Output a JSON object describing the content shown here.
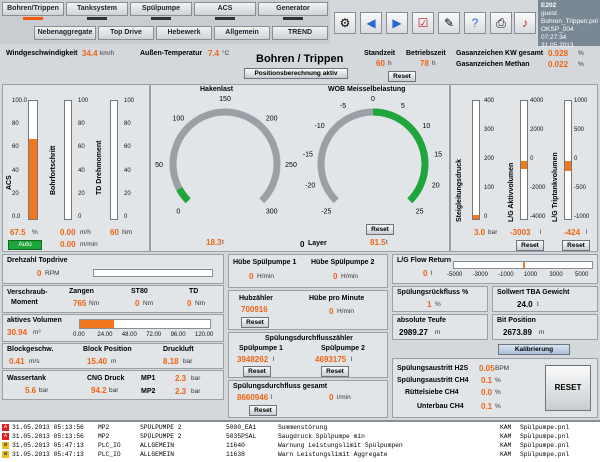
{
  "nav": {
    "row1": [
      "Bohren/Trippen",
      "Tanksystem",
      "Spülpumpe",
      "ACS",
      "Generator"
    ],
    "row2": [
      "Nebenaggregate",
      "Top Drive",
      "Hebewerk",
      "Allgemein",
      "TREND"
    ]
  },
  "toolbar": {
    "icons": [
      "settings-icon",
      "back-arrow-icon",
      "forward-arrow-icon",
      "checklist-icon",
      "tools-icon",
      "help-icon",
      "printer-icon",
      "alarm-bell-icon"
    ]
  },
  "user": {
    "id": "E202",
    "name": "guest",
    "file": "Bohren_Trippen.pnl",
    "oksp": "OKSP_004",
    "datetime": "07:27:34 31.05.2013"
  },
  "header": {
    "wind_label": "Windgeschwindigkeit",
    "wind_value": "34.4",
    "wind_unit": "km/h",
    "temp_label": "Außen-Temperatur",
    "temp_value": "7.4",
    "temp_unit": "°C",
    "title": "Bohren / Trippen",
    "pos_button": "Positionsberechnung aktiv",
    "standzeit_label": "Standzeit",
    "standzeit_value": "60",
    "standzeit_unit": "h",
    "betrieb_label": "Betriebszeit",
    "betrieb_value": "78",
    "betrieb_unit": "h",
    "reset": "Reset",
    "gas_kw_label": "Gasanzeichen KW gesamt",
    "gas_kw_value": "0.928",
    "gas_kw_unit": "%",
    "gas_methan_label": "Gasanzeichen Methan",
    "gas_methan_value": "0.022",
    "gas_methan_unit": "%"
  },
  "left_bars": {
    "acs": {
      "label": "ACS",
      "value": "67.5",
      "unit": "%",
      "fraction": 0.675,
      "button": "Auto"
    },
    "bohrfort": {
      "label": "Bohrfortschritt",
      "value": "0.00",
      "unit": "m/h",
      "fraction": 0.0
    },
    "td": {
      "label": "TD Drehmoment",
      "value": "60",
      "unit": "Nm",
      "fraction": 0.0
    },
    "scale1": [
      "100.0",
      "80",
      "60",
      "40",
      "20",
      "0.0"
    ],
    "scale2": [
      "100",
      "80",
      "60",
      "40",
      "20",
      "0"
    ],
    "min_label_value": "0.00",
    "min_label_unit": "m/min"
  },
  "hakenlast": {
    "label": "Hakenlast",
    "value": "18.3",
    "unit": "t",
    "ticks": [
      "0",
      "50",
      "100",
      "150",
      "200",
      "250",
      "300"
    ],
    "gauge_value": 18.3,
    "gauge_max": 300
  },
  "wob": {
    "label": "WOB Meisselbelastung",
    "value": "81.5",
    "unit": "t",
    "ticks": [
      "-25",
      "-20",
      "-15",
      "-10",
      "-5",
      "0",
      "5",
      "10",
      "15",
      "20",
      "25"
    ],
    "gauge_value": 25,
    "gauge_min": -25,
    "gauge_max": 25,
    "reset": "Reset"
  },
  "layer": {
    "value": "0",
    "label": "Layer"
  },
  "right_bars": {
    "steig": {
      "label": "Steigleitungsdruck",
      "value": "3.0",
      "unit": "bar",
      "fraction": 0.03
    },
    "lg_aktiv": {
      "label": "L/G Aktivvolumen",
      "value": "-3003",
      "unit": "l",
      "fraction": 0.5,
      "reset": "Reset"
    },
    "lg_trip": {
      "label": "L/G Triptankvolumen",
      "value": "-424",
      "unit": "l",
      "fraction": 0.5,
      "reset": "Reset"
    },
    "scale_a": [
      "400",
      "300",
      "200",
      "100",
      "0"
    ],
    "scale_b": [
      "4000",
      "2000",
      "0",
      "-2000",
      "-4000"
    ],
    "scale_c": [
      "1000",
      "500",
      "0",
      "-500",
      "-1000"
    ]
  },
  "drehzahl": {
    "label": "Drehzahl Topdrive",
    "value": "0",
    "unit": "RPM"
  },
  "verschraub": {
    "label1": "Verschraub-",
    "label2": "Moment",
    "zangen_label": "Zangen",
    "zangen_value": "765",
    "zangen_unit": "Nm",
    "st80_label": "ST80",
    "st80_value": "0",
    "st80_unit": "Nm",
    "td_label": "TD",
    "td_value": "0",
    "td_unit": "Nm"
  },
  "aktiv_volumen": {
    "label": "aktives Volumen",
    "value": "30.94",
    "unit": "m³",
    "scale": [
      "0.00",
      "24.00",
      "48.00",
      "72.00",
      "96.00",
      "120.00"
    ],
    "fraction": 0.26
  },
  "blockgeschw": {
    "label": "Blockgeschw.",
    "value": "0.41",
    "unit": "m/s"
  },
  "blockpos": {
    "label": "Block Position",
    "value": "15.40",
    "unit": "m"
  },
  "druckluft": {
    "label": "Druckluft",
    "value": "8.18",
    "unit": "bar"
  },
  "wassertank": {
    "label": "Wassertank",
    "value": "5.6",
    "unit": "bar"
  },
  "cng": {
    "label": "CNG Druck",
    "value": "94.2",
    "unit": "bar"
  },
  "mp1": {
    "label": "MP1",
    "value": "2.3",
    "unit": "bar"
  },
  "mp2": {
    "label": "MP2",
    "value": "2.3",
    "unit": "bar"
  },
  "huebe": {
    "sp1_label": "Hübe Spülpumpe 1",
    "sp1_value": "0",
    "sp1_unit": "H/min",
    "sp2_label": "Hübe Spülpumpe 2",
    "sp2_value": "0",
    "sp2_unit": "H/min"
  },
  "hubzahler": {
    "label": "Hubzähler",
    "value": "700916",
    "reset": "Reset",
    "hpm_label": "Hübe pro Minute",
    "hpm_value": "0",
    "hpm_unit": "H/min"
  },
  "spuelzaehler": {
    "label": "Spülungsdurchflusszähler",
    "p1_label": "Spülpumpe 1",
    "p1_value": "3948262",
    "p1_unit": "l",
    "p2_label": "Spülpumpe 2",
    "p2_value": "4693175",
    "p2_unit": "l",
    "reset": "Reset"
  },
  "spuel_gesamt": {
    "label": "Spülungsdurchfluss gesamt",
    "value": "8660946",
    "unit": "l",
    "value2": "0",
    "unit2": "l/min",
    "reset": "Reset"
  },
  "lg_flow": {
    "label": "L/G Flow Return",
    "value": "0",
    "unit": "l",
    "scale": [
      "-5000",
      "-3000",
      "-1000",
      "1000",
      "3000",
      "5000"
    ]
  },
  "rueckfluss": {
    "label": "Spülungsrückfluss %",
    "value": "1",
    "unit": "%"
  },
  "sollwert": {
    "label": "Sollwert TBA Gewicht",
    "value": "24.0",
    "unit": "t"
  },
  "teufe": {
    "label": "absolute Teufe",
    "value": "2989.27",
    "unit": "m"
  },
  "bitpos": {
    "label": "Bit Position",
    "value": "2673.89",
    "unit": "m"
  },
  "kalibrierung": "Kalibrierung",
  "austritt": {
    "h2s_label": "Spülungsaustritt H2S",
    "h2s_value": "0.05",
    "h2s_unit": "BPM",
    "ch4_label": "Spülungsaustritt CH4",
    "ch4_value": "0.1",
    "ch4_unit": "%",
    "ruettel_label": "Rüttelsiebe CH4",
    "ruettel_value": "0.0",
    "ruettel_unit": "%",
    "unterbau_label": "Unterbau CH4",
    "unterbau_value": "0.1",
    "unterbau_unit": "%",
    "reset": "RESET"
  },
  "alarms": [
    {
      "sev": "A",
      "sev_color": "#e02020",
      "date": "31.05.2013 05:13:56",
      "code": "MP2",
      "group": "SPÜLPUMPE 2",
      "id": "5000_EA1",
      "text": "Summenstörung",
      "user": "KAM",
      "file": "Spülpumpe.pnl"
    },
    {
      "sev": "A",
      "sev_color": "#e02020",
      "date": "31.05.2013 05:13:56",
      "code": "MP2",
      "group": "SPÜLPUMPE 2",
      "id": "5035PSAL",
      "text": "Saugdruck Spülpumpe min",
      "user": "KAM",
      "file": "Spülpumpe.pnl"
    },
    {
      "sev": "W",
      "sev_color": "#e8c020",
      "date": "31.05.2013 05:47:13",
      "code": "PLC_IO",
      "group": "ALLGEMEIN",
      "id": "11640",
      "text": "Warnung Leistungslimit Spülpumpen",
      "user": "KAM",
      "file": "Spülpumpe.pnl"
    },
    {
      "sev": "W",
      "sev_color": "#e8c020",
      "date": "31.05.2013 05:47:13",
      "code": "PLC_IO",
      "group": "ALLGEMEIN",
      "id": "11638",
      "text": "Warn Leistungslimit Aggregate",
      "user": "KAM",
      "file": "Spülpumpe.pnl"
    }
  ]
}
